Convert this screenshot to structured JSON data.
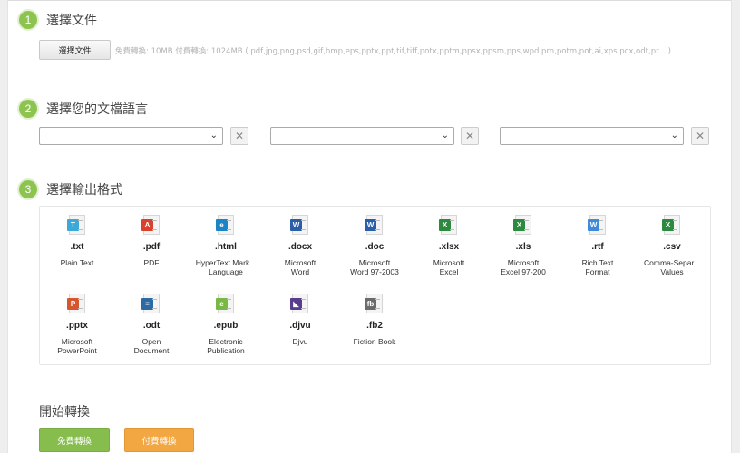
{
  "steps": [
    {
      "number": "1",
      "title": "選擇文件"
    },
    {
      "number": "2",
      "title": "選擇您的文檔語言"
    },
    {
      "number": "3",
      "title": "選擇輸出格式"
    }
  ],
  "file": {
    "button_label": "選擇文件",
    "info": "免費轉換: 10MB  付費轉換: 1024MB  ( pdf,jpg,png,psd,gif,bmp,eps,pptx,ppt,tif,tiff,potx,pptm,ppsx,ppsm,pps,wpd,prn,potm,pot,ai,xps,pcx,odt,pr... )"
  },
  "language": {
    "selects": [
      {
        "value": ""
      },
      {
        "value": ""
      },
      {
        "value": ""
      }
    ],
    "clear_label": "✕"
  },
  "formats": [
    {
      "ext": ".txt",
      "label": "Plain Text",
      "icon": "txt-file-icon",
      "badge": "T",
      "color": "#3aa9d8"
    },
    {
      "ext": ".pdf",
      "label": "PDF",
      "icon": "pdf-file-icon",
      "badge": "A",
      "color": "#d9412f"
    },
    {
      "ext": ".html",
      "label": "HyperText Mark...\nLanguage",
      "icon": "html-file-icon",
      "badge": "e",
      "color": "#1b84c6"
    },
    {
      "ext": ".docx",
      "label": "Microsoft\nWord",
      "icon": "word-file-icon",
      "badge": "W",
      "color": "#2b5ea8"
    },
    {
      "ext": ".doc",
      "label": "Microsoft\nWord 97-2003",
      "icon": "word-file-icon",
      "badge": "W",
      "color": "#2b5ea8"
    },
    {
      "ext": ".xlsx",
      "label": "Microsoft\nExcel",
      "icon": "excel-file-icon",
      "badge": "X",
      "color": "#2b8a3e"
    },
    {
      "ext": ".xls",
      "label": "Microsoft\nExcel 97-200",
      "icon": "excel-file-icon",
      "badge": "X",
      "color": "#2b8a3e"
    },
    {
      "ext": ".rtf",
      "label": "Rich Text\nFormat",
      "icon": "rtf-file-icon",
      "badge": "W",
      "color": "#3f8ad6"
    },
    {
      "ext": ".csv",
      "label": "Comma-Separ...\nValues",
      "icon": "csv-file-icon",
      "badge": "X",
      "color": "#2b8a3e"
    },
    {
      "ext": ".pptx",
      "label": "Microsoft\nPowerPoint",
      "icon": "powerpoint-file-icon",
      "badge": "P",
      "color": "#d4572f"
    },
    {
      "ext": ".odt",
      "label": "Open\nDocument",
      "icon": "odt-file-icon",
      "badge": "≡",
      "color": "#2d6aa3"
    },
    {
      "ext": ".epub",
      "label": "Electronic\nPublication",
      "icon": "epub-file-icon",
      "badge": "e",
      "color": "#79b843"
    },
    {
      "ext": ".djvu",
      "label": "Djvu",
      "icon": "djvu-file-icon",
      "badge": "◣",
      "color": "#5a3c8c"
    },
    {
      "ext": ".fb2",
      "label": "Fiction Book",
      "icon": "fb2-file-icon",
      "badge": "fb",
      "color": "#6b6b6b"
    }
  ],
  "start": {
    "title": "開始轉換",
    "free_label": "免費轉換",
    "paid_label": "付費轉換"
  },
  "colors": {
    "step_accent": "#8cc44f",
    "free_button": "#86bd4c",
    "paid_button": "#f2a743"
  }
}
